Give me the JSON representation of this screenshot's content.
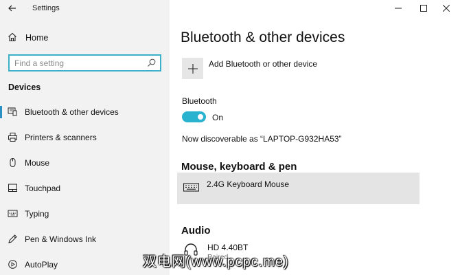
{
  "app": {
    "title": "Settings"
  },
  "sidebar": {
    "home_label": "Home",
    "search_placeholder": "Find a setting",
    "section_title": "Devices",
    "items": [
      {
        "label": "Bluetooth & other devices",
        "icon": "bluetooth-devices-icon",
        "selected": true
      },
      {
        "label": "Printers & scanners",
        "icon": "printer-icon",
        "selected": false
      },
      {
        "label": "Mouse",
        "icon": "mouse-icon",
        "selected": false
      },
      {
        "label": "Touchpad",
        "icon": "touchpad-icon",
        "selected": false
      },
      {
        "label": "Typing",
        "icon": "keyboard-icon",
        "selected": false
      },
      {
        "label": "Pen & Windows Ink",
        "icon": "pen-icon",
        "selected": false
      },
      {
        "label": "AutoPlay",
        "icon": "autoplay-icon",
        "selected": false
      }
    ]
  },
  "main": {
    "title": "Bluetooth & other devices",
    "add_device_label": "Add Bluetooth or other device",
    "bluetooth_label": "Bluetooth",
    "bluetooth_state": "On",
    "discoverable_text": "Now discoverable as “LAPTOP-G932HA53”",
    "mouse_section_title": "Mouse, keyboard & pen",
    "mouse_devices": [
      {
        "name": "2.4G Keyboard Mouse",
        "icon": "keyboard-icon"
      }
    ],
    "audio_section_title": "Audio",
    "audio_devices": [
      {
        "name": "HD 4.40BT",
        "status": "Paired",
        "icon": "headphones-icon"
      }
    ]
  },
  "watermark": "双电网(www.pcpc.me)",
  "colors": {
    "accent": "#2ab3cf",
    "selection_bar": "#2a8fc1",
    "sidebar_bg": "#f2f2f2",
    "search_border": "#3bb0c9",
    "device_row_bg": "#e4e4e4"
  }
}
